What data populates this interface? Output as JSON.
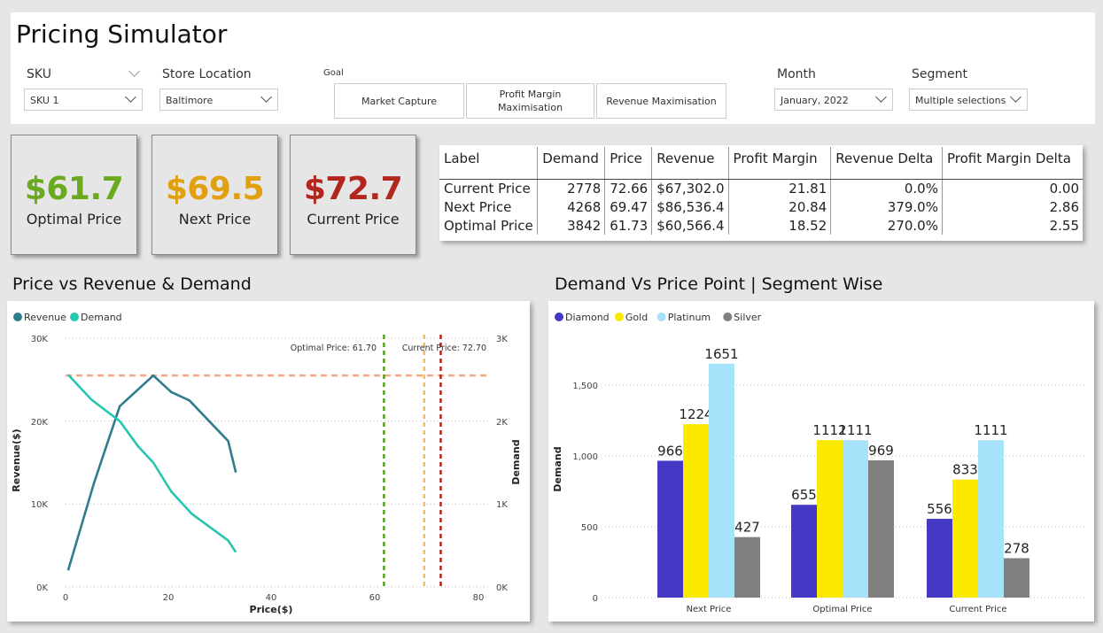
{
  "header": {
    "title": "Pricing Simulator",
    "sku": {
      "label": "SKU",
      "value": "SKU 1"
    },
    "store": {
      "label": "Store Location",
      "value": "Baltimore"
    },
    "goal": {
      "label": "Goal",
      "options": [
        "Market Capture",
        "Profit Margin Maximisation",
        "Revenue Maximisation"
      ]
    },
    "month": {
      "label": "Month",
      "value": "January, 2022"
    },
    "segment": {
      "label": "Segment",
      "value": "Multiple selections"
    }
  },
  "kpis": [
    {
      "value": "$61.7",
      "label": "Optimal Price",
      "color": "#6aaa1e"
    },
    {
      "value": "$69.5",
      "label": "Next Price",
      "color": "#e0a010"
    },
    {
      "value": "$72.7",
      "label": "Current Price",
      "color": "#b3261e"
    }
  ],
  "table": {
    "headers": [
      "Label",
      "Demand",
      "Price",
      "Revenue",
      "Profit Margin",
      "Revenue Delta",
      "Profit Margin Delta"
    ],
    "rows": [
      [
        "Current Price",
        "2778",
        "72.66",
        "$67,302.0",
        "21.81",
        "0.0%",
        "0.00"
      ],
      [
        "Next Price",
        "4268",
        "69.47",
        "$86,536.4",
        "20.84",
        "379.0%",
        "2.86"
      ],
      [
        "Optimal Price",
        "3842",
        "61.73",
        "$60,566.4",
        "18.52",
        "270.0%",
        "2.55"
      ]
    ]
  },
  "left_chart": {
    "section_title": "Price vs Revenue & Demand",
    "legend": [
      "Revenue",
      "Demand"
    ],
    "xlabel": "Price($)",
    "ylabel_left": "Revenue($)",
    "ylabel_right": "Demand",
    "y_ticks_left": [
      "0K",
      "10K",
      "20K",
      "30K"
    ],
    "y_ticks_right": [
      "0K",
      "1K",
      "2K",
      "3K"
    ],
    "x_ticks": [
      "0",
      "20",
      "40",
      "60",
      "80"
    ],
    "annotations": [
      "Optimal Price: 61.70",
      "Current Price: 72.70"
    ]
  },
  "right_chart": {
    "section_title": "Demand Vs Price Point | Segment Wise",
    "ylabel": "Demand",
    "y_ticks": [
      "0",
      "500",
      "1,000",
      "1,500"
    ]
  },
  "chart_data": [
    {
      "type": "line",
      "xlabel": "Price($)",
      "ylabel": "Revenue($)",
      "y2label": "Demand",
      "xlim": [
        0,
        80
      ],
      "ylim": [
        0,
        30000
      ],
      "y2lim": [
        0,
        3000
      ],
      "series": [
        {
          "name": "Revenue",
          "axis": "left",
          "color": "#2e7c8c",
          "x": [
            0.5,
            5.5,
            10.5,
            17,
            20.5,
            24,
            31.5,
            33
          ],
          "y": [
            2000,
            12500,
            21800,
            25500,
            23500,
            22500,
            17600,
            13800
          ]
        },
        {
          "name": "Demand",
          "axis": "right",
          "color": "#26c6b0",
          "x": [
            0.5,
            5,
            10.5,
            14,
            17,
            20.5,
            24.5,
            31.5,
            33
          ],
          "y": [
            2560,
            2260,
            2000,
            1700,
            1500,
            1150,
            880,
            560,
            420
          ]
        }
      ],
      "reference_lines": [
        {
          "orientation": "horizontal",
          "axis": "left",
          "value": 25500,
          "color": "#f2a98a"
        },
        {
          "orientation": "vertical",
          "value": 61.7,
          "color": "#5aa01e",
          "label": "Optimal Price: 61.70"
        },
        {
          "orientation": "vertical",
          "value": 69.5,
          "color": "#f0c060"
        },
        {
          "orientation": "vertical",
          "value": 72.7,
          "color": "#b3261e",
          "label": "Current Price: 72.70"
        }
      ],
      "legend": "top-left",
      "grid": true
    },
    {
      "type": "bar",
      "ylabel": "Demand",
      "ylim": [
        0,
        1800
      ],
      "categories": [
        "Next Price",
        "Optimal Price",
        "Current Price"
      ],
      "series": [
        {
          "name": "Diamond",
          "color": "#4538c4",
          "values": [
            966,
            655,
            556
          ]
        },
        {
          "name": "Gold",
          "color": "#fce900",
          "values": [
            1224,
            1112,
            833
          ]
        },
        {
          "name": "Platinum",
          "color": "#a6e3fb",
          "values": [
            1651,
            1111,
            1111
          ]
        },
        {
          "name": "Silver",
          "color": "#7f7f7f",
          "values": [
            427,
            969,
            278
          ]
        }
      ],
      "legend": "top-left",
      "grid": true,
      "data_labels": true
    }
  ]
}
